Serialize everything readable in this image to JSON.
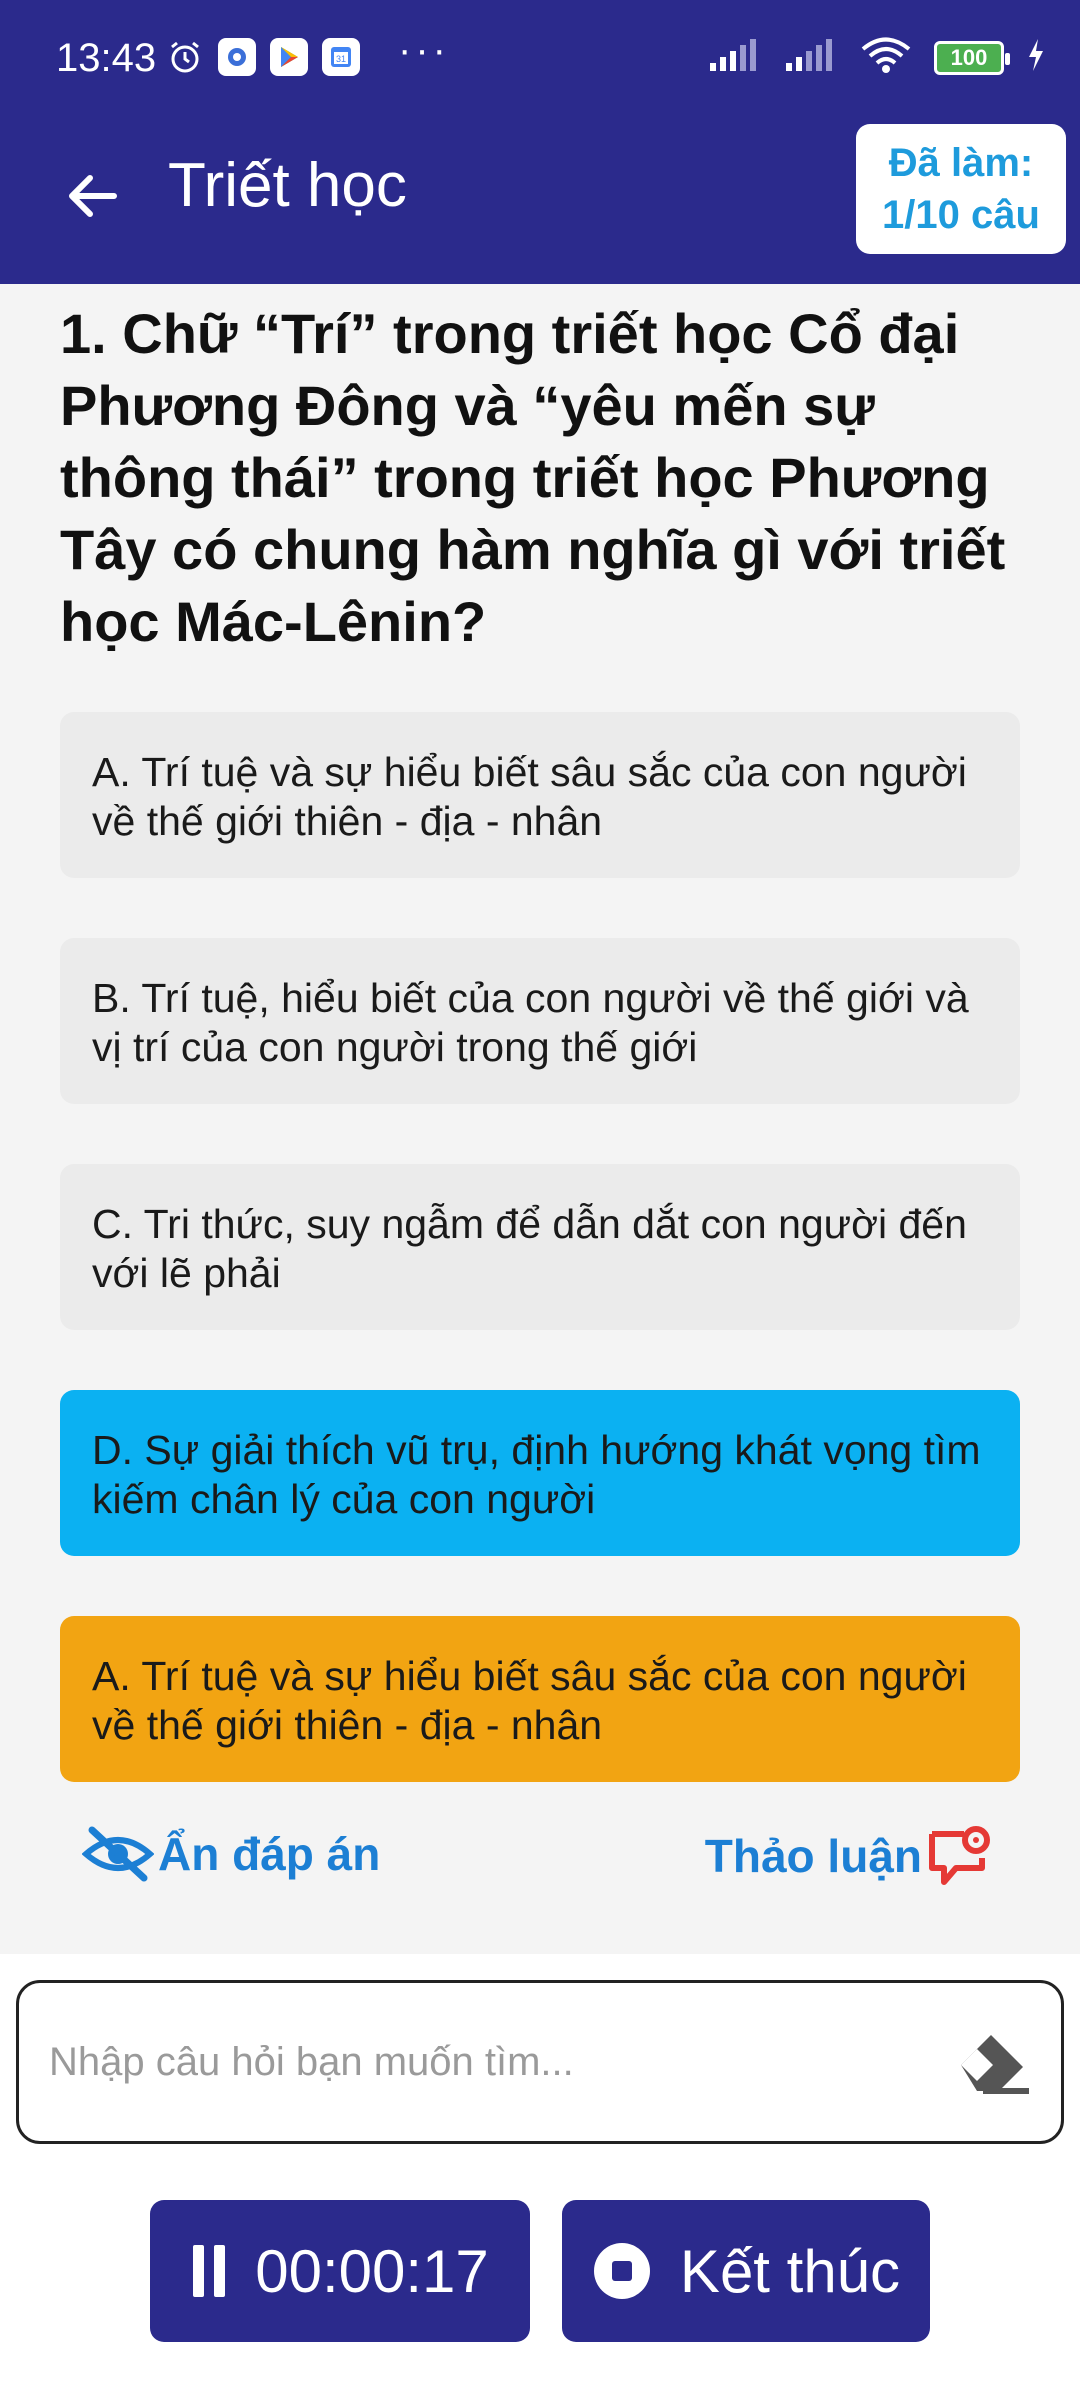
{
  "status_bar": {
    "time": "13:43",
    "battery": "100",
    "icons": [
      "alarm-icon",
      "settings-app-icon",
      "play-store-icon",
      "calendar-icon",
      "more-dots",
      "signal-icon",
      "signal-icon",
      "wifi-icon",
      "battery-icon",
      "charging-icon"
    ]
  },
  "app_bar": {
    "title": "Triết học",
    "progress_line1": "Đã làm:",
    "progress_line2": "1/10 câu"
  },
  "question": {
    "text": "1. Chữ “Trí” trong triết học Cổ đại Phương Đông và “yêu mến sự thông thái” trong triết học Phương Tây có chung hàm nghĩa gì với triết học Mác-Lênin?"
  },
  "options": [
    {
      "text": "A. Trí tuệ và sự hiểu biết sâu sắc của con người về thế giới thiên - địa - nhân",
      "state": "default"
    },
    {
      "text": "B. Trí tuệ, hiểu biết của con người về thế giới và vị trí của con người trong thế giới",
      "state": "default"
    },
    {
      "text": "C. Tri thức, suy ngẫm để dẫn dắt con người đến với lẽ phải",
      "state": "default"
    },
    {
      "text": "D. Sự giải thích vũ trụ, định hướng khát vọng tìm kiếm chân lý của con người",
      "state": "selected"
    }
  ],
  "answer": {
    "text": "A. Trí tuệ và sự hiểu biết sâu sắc của con người về thế giới thiên - địa - nhân"
  },
  "actions": {
    "hide_answer": "Ẩn đáp án",
    "discuss": "Thảo luận"
  },
  "search": {
    "placeholder": "Nhập câu hỏi bạn muốn tìm...",
    "value": ""
  },
  "bottom": {
    "timer": "00:00:17",
    "finish": "Kết thúc"
  },
  "colors": {
    "primary": "#2b2a8c",
    "selected": "#0bb1f2",
    "correct": "#f2a412",
    "link": "#1c7fd4",
    "discuss_icon": "#e53935"
  }
}
